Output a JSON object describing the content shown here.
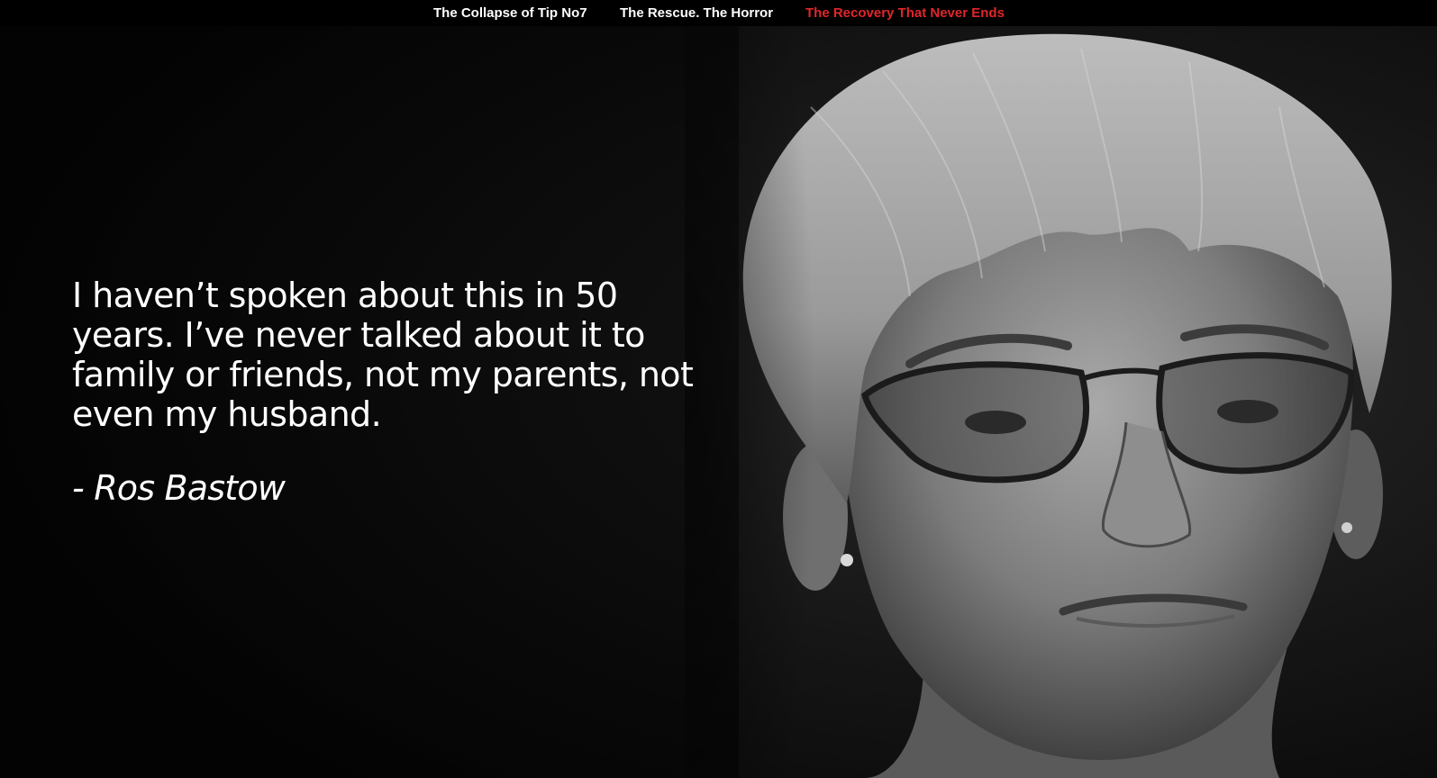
{
  "nav": {
    "items": [
      {
        "label": "The Collapse of Tip No7",
        "active": false
      },
      {
        "label": "The Rescue. The Horror",
        "active": false
      },
      {
        "label": "The Recovery  That Never Ends",
        "active": true
      }
    ],
    "active_color": "#e0262a",
    "link_color": "#ffffff",
    "background": "#000000"
  },
  "hero": {
    "image_icon": "portrait-photo-icon",
    "quote": "I haven’t spoken about this in 50 years. I’ve never talked about it to family or friends, not my parents, not even my husband.",
    "attribution": "- Ros Bastow",
    "text_color": "#ffffff",
    "background": "#0b0b0b"
  }
}
